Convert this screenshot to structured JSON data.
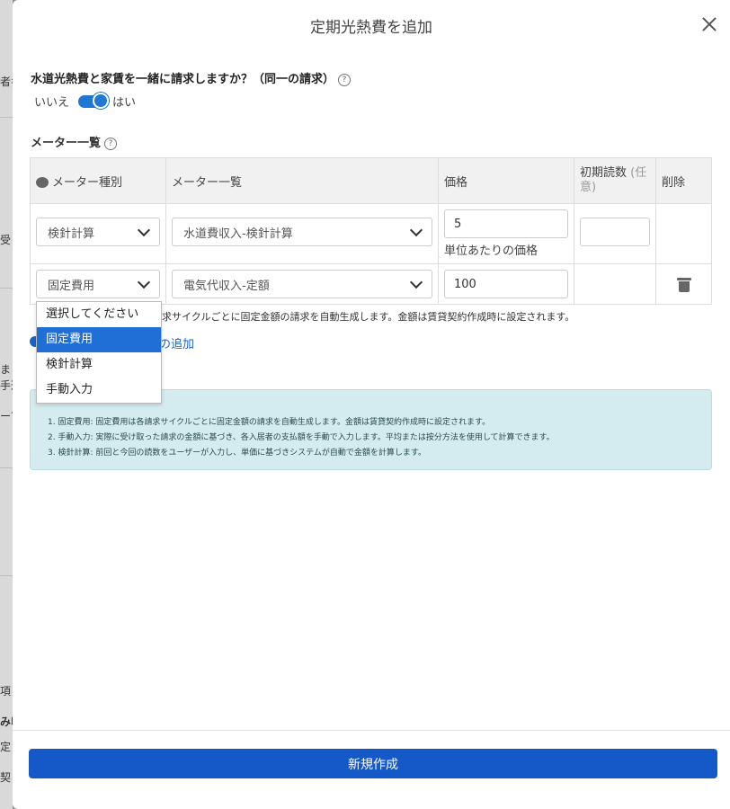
{
  "background": {
    "fragments": [
      "者名",
      "受",
      "ま",
      "手遣",
      "ーブ",
      "項",
      "み収",
      "定",
      "契"
    ]
  },
  "modal": {
    "title": "定期光熱費を追加",
    "question": "水道光熱費と家賃を一緒に請求しますか？（同一の請求）",
    "toggle": {
      "off_label": "いいえ",
      "on_label": "はい",
      "value": "on"
    },
    "meter_section_label": "メーター一覧",
    "table": {
      "headers": {
        "type": "メーター種別",
        "list": "メーター一覧",
        "price": "価格",
        "initial_reading": "初期読数",
        "initial_optional": "(任意)",
        "delete": "削除"
      },
      "rows": [
        {
          "type": "検針計算",
          "meter": "水道費収入-検針計算",
          "price": "5",
          "price_note": "単位あたりの価格",
          "initial_reading": ""
        },
        {
          "type": "固定費用",
          "meter": "電気代収入-定額",
          "price": "100"
        }
      ]
    },
    "dropdown_options": [
      "選択してください",
      "固定費用",
      "検針計算",
      "手動入力"
    ],
    "dropdown_selected": "固定費用",
    "row_description": "求サイクルごとに固定金額の請求を自動生成します。金額は賃貸契約作成時に設定されます。",
    "add_link": "の追加",
    "info_lines": [
      "1. 固定費用: 固定費用は各請求サイクルごとに固定金額の請求を自動生成します。金額は賃貸契約作成時に設定されます。",
      "2. 手動入力: 実際に受け取った請求の金額に基づき、各入居者の支払額を手動で入力します。平均または按分方法を使用して計算できます。",
      "3. 検針計算: 前回と今回の読数をユーザーが入力し、単価に基づきシステムが自動で金額を計算します。"
    ],
    "create_button": "新規作成"
  }
}
